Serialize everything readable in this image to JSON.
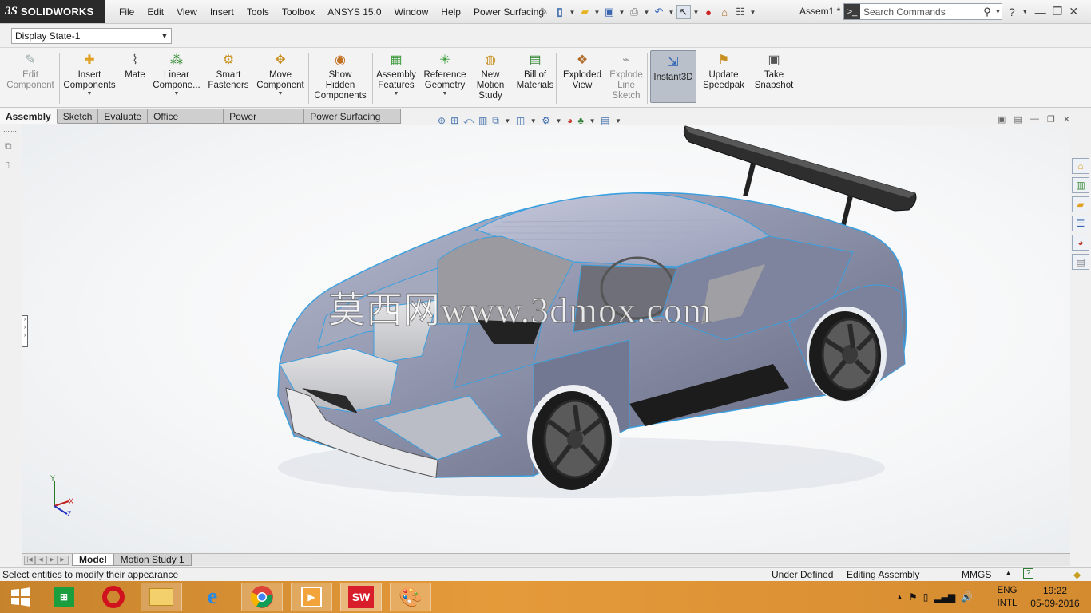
{
  "title_bar": {
    "logo_ds": "3S",
    "logo_text": "SOLIDWORKS",
    "menu": [
      "File",
      "Edit",
      "View",
      "Insert",
      "Tools",
      "Toolbox",
      "ANSYS 15.0",
      "Window",
      "Help",
      "Power Surfacing"
    ],
    "document_name": "Assem1 *",
    "search_placeholder": "Search Commands"
  },
  "display_state": {
    "selected": "Display State-1"
  },
  "command_manager": {
    "buttons": [
      {
        "label": "Edit\nComponent",
        "icon": "edit-component-icon",
        "enabled": false
      },
      {
        "label": "Insert\nComponents",
        "icon": "insert-components-icon",
        "enabled": true
      },
      {
        "label": "Mate",
        "icon": "mate-paperclip-icon",
        "enabled": true
      },
      {
        "label": "Linear\nCompone...",
        "icon": "linear-pattern-icon",
        "enabled": true
      },
      {
        "label": "Smart\nFasteners",
        "icon": "smart-fasteners-icon",
        "enabled": true
      },
      {
        "label": "Move\nComponent",
        "icon": "move-component-icon",
        "enabled": true
      },
      {
        "label": "Show\nHidden\nComponents",
        "icon": "show-hidden-icon",
        "enabled": true
      },
      {
        "label": "Assembly\nFeatures",
        "icon": "assembly-features-icon",
        "enabled": true
      },
      {
        "label": "Reference\nGeometry",
        "icon": "reference-geometry-icon",
        "enabled": true
      },
      {
        "label": "New\nMotion\nStudy",
        "icon": "motion-study-icon",
        "enabled": true
      },
      {
        "label": "Bill of\nMaterials",
        "icon": "bill-of-materials-icon",
        "enabled": true
      },
      {
        "label": "Exploded\nView",
        "icon": "exploded-view-icon",
        "enabled": true
      },
      {
        "label": "Explode\nLine\nSketch",
        "icon": "explode-line-sketch-icon",
        "enabled": false
      },
      {
        "label": "Instant3D",
        "icon": "instant3d-icon",
        "enabled": true
      },
      {
        "label": "Update\nSpeedpak",
        "icon": "speedpak-icon",
        "enabled": true
      },
      {
        "label": "Take\nSnapshot",
        "icon": "snapshot-icon",
        "enabled": true
      }
    ]
  },
  "tabs": [
    "Assembly",
    "Sketch",
    "Evaluate",
    "Office Products",
    "Power Surfacing",
    "Power Surfacing RE"
  ],
  "active_tab": "Assembly",
  "viewport": {
    "watermark": "莫西网www.3dmox.com",
    "triad": {
      "x": "X",
      "y": "Y",
      "z": "Z"
    }
  },
  "bottom_tabs": [
    "Model",
    "Motion Study 1"
  ],
  "status_bar": {
    "message": "Select entities to modify their appearance",
    "state": "Under Defined",
    "mode": "Editing Assembly",
    "units": "MMGS"
  },
  "taskbar": {
    "apps": [
      "start",
      "store",
      "opera",
      "file-explorer",
      "internet-explorer",
      "chrome",
      "media-player",
      "solidworks",
      "paint"
    ],
    "lang_top": "ENG",
    "lang_bottom": "INTL",
    "time": "19:22",
    "date": "05-09-2016"
  },
  "colors": {
    "body_paint": "#8d93ad",
    "edge_highlight": "#3aa0e0",
    "wing": "#2f2f2f",
    "taskbar": "#d98e33"
  }
}
